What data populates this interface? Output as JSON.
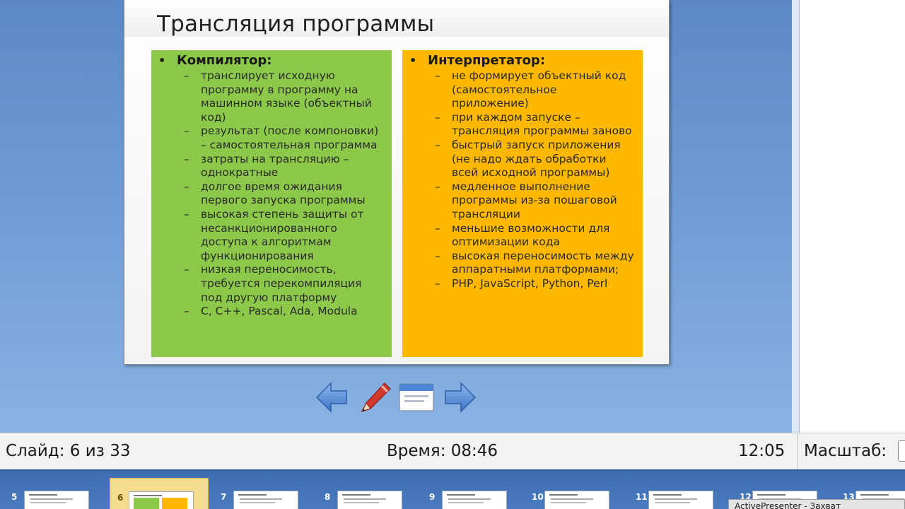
{
  "slide": {
    "title": "Трансляция программы",
    "left": {
      "heading": "Компилятор:",
      "items": [
        "транслирует исходную программу в программу на машинном языке (объектный код)",
        "результат (после компоновки) – самостоятельная программа",
        "затраты на трансляцию – однократные",
        "долгое время ожидания первого запуска программы",
        "высокая степень защиты от несанкционированного доступа к алгоритмам функционирования",
        "низкая переносимость, требуется перекомпиляция под другую платформу",
        "C, C++, Pascal, Ada, Modula"
      ]
    },
    "right": {
      "heading": "Интерпретатор:",
      "items": [
        "не формирует объектный код (самостоятельное приложение)",
        "при каждом запуске – трансляция программы заново",
        "быстрый запуск приложения (не надо ждать обработки всей исходной программы)",
        "медленное выполнение программы из-за пошаговой трансляции",
        "меньшие возможности для оптимизации кода",
        "высокая переносимость между аппаратными платформами;",
        "PHP, JavaScript, Python, Perl"
      ]
    },
    "bullet": "•",
    "dash": "–"
  },
  "nav": {
    "prev_icon": "arrow-left-icon",
    "pen_icon": "pen-icon",
    "menu_icon": "slide-menu-icon",
    "next_icon": "arrow-right-icon"
  },
  "status": {
    "slide_text": "Слайд: 6 из 33",
    "time_text": "Время: 08:46",
    "clock": "12:05",
    "zoom_label": "Масштаб:"
  },
  "thumbnails": [
    {
      "num": "5"
    },
    {
      "num": "6",
      "active": true
    },
    {
      "num": "7"
    },
    {
      "num": "8"
    },
    {
      "num": "9"
    },
    {
      "num": "10"
    },
    {
      "num": "11"
    },
    {
      "num": "12"
    },
    {
      "num": "13"
    }
  ],
  "taskbar_popup": "ActivePresenter - Захват",
  "colors": {
    "compiler_column": "#8cc84a",
    "interpreter_column": "#ffb800",
    "stage": "#6c99d3",
    "thumb_strip": "#4a7bbf",
    "active_thumb": "#f5dc8e",
    "arrow": "#4d86d6",
    "pen": "#d33a2e"
  }
}
